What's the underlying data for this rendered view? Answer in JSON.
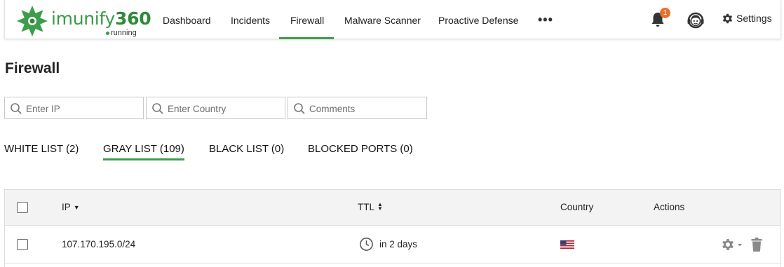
{
  "app": {
    "logo_text_light": "imunify",
    "logo_text_bold": "360",
    "status": "running",
    "brand_color": "#3e9d4a",
    "badge_color": "#e8702a"
  },
  "nav": {
    "items": [
      {
        "label": "Dashboard",
        "active": false
      },
      {
        "label": "Incidents",
        "active": false
      },
      {
        "label": "Firewall",
        "active": true
      },
      {
        "label": "Malware Scanner",
        "active": false
      },
      {
        "label": "Proactive Defense",
        "active": false
      }
    ],
    "more_label": "•••",
    "notifications_count": "1",
    "settings_label": "Settings"
  },
  "page": {
    "title": "Firewall"
  },
  "filters": {
    "ip_placeholder": "Enter IP",
    "country_placeholder": "Enter Country",
    "comments_placeholder": "Comments"
  },
  "tabs": [
    {
      "label": "WHITE LIST (2)",
      "active": false
    },
    {
      "label": "GRAY LIST (109)",
      "active": true
    },
    {
      "label": "BLACK LIST (0)",
      "active": false
    },
    {
      "label": "BLOCKED PORTS (0)",
      "active": false
    }
  ],
  "table": {
    "columns": {
      "ip": "IP",
      "ttl": "TTL",
      "country": "Country",
      "actions": "Actions"
    },
    "rows": [
      {
        "ip": "107.170.195.0/24",
        "ttl": "in 2 days",
        "country_flag": "us-flag-icon"
      }
    ]
  }
}
